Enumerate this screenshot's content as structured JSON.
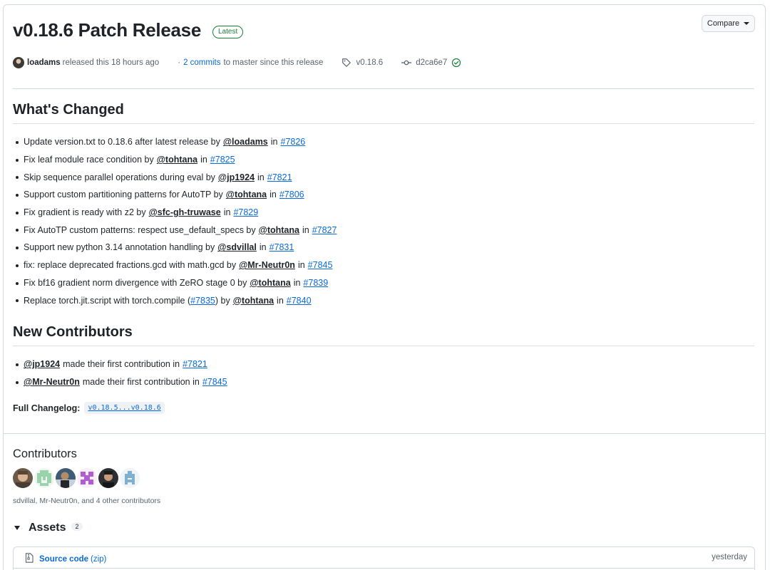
{
  "release": {
    "title": "v0.18.6 Patch Release",
    "badge": "Latest",
    "compare_label": "Compare",
    "author": "loadams",
    "released_text": "released this 18 hours ago",
    "commits_link": "2 commits",
    "commits_suffix": "to master since this release",
    "tag": "v0.18.6",
    "commit_sha": "d2ca6e7"
  },
  "whats_changed": {
    "heading": "What's Changed",
    "items": [
      {
        "text": "Update version.txt to 0.18.6 after latest release by",
        "user": "@loadams",
        "in": "in",
        "pr": "#7826"
      },
      {
        "text": "Fix leaf module race condition by",
        "user": "@tohtana",
        "in": "in",
        "pr": "#7825"
      },
      {
        "text": "Skip sequence parallel operations during eval by",
        "user": "@jp1924",
        "in": "in",
        "pr": "#7821"
      },
      {
        "text": "Support custom partitioning patterns for AutoTP by",
        "user": "@tohtana",
        "in": "in",
        "pr": "#7806"
      },
      {
        "text": "Fix gradient is ready with z2 by",
        "user": "@sfc-gh-truwase",
        "in": "in",
        "pr": "#7829"
      },
      {
        "text": "Fix AutoTP custom patterns: respect use_default_specs by",
        "user": "@tohtana",
        "in": "in",
        "pr": "#7827"
      },
      {
        "text": "Support new python 3.14 annotation handling by",
        "user": "@sdvillal",
        "in": "in",
        "pr": "#7831"
      },
      {
        "text": "fix: replace deprecated fractions.gcd with math.gcd by",
        "user": "@Mr-Neutr0n",
        "in": "in",
        "pr": "#7845"
      },
      {
        "text": "Fix bf16 gradient norm divergence with ZeRO stage 0 by",
        "user": "@tohtana",
        "in": "in",
        "pr": "#7839"
      }
    ],
    "last_item": {
      "prefix": "Replace torch.jit.script with torch.compile (",
      "inner_pr": "#7835",
      "mid": ") by",
      "user": "@tohtana",
      "in": "in",
      "pr": "#7840"
    }
  },
  "new_contributors": {
    "heading": "New Contributors",
    "items": [
      {
        "user": "@jp1924",
        "text": "made their first contribution in",
        "pr": "#7821"
      },
      {
        "user": "@Mr-Neutr0n",
        "text": "made their first contribution in",
        "pr": "#7845"
      }
    ]
  },
  "changelog": {
    "label": "Full Changelog",
    "colon": ":",
    "range": "v0.18.5...v0.18.6"
  },
  "contributors": {
    "heading": "Contributors",
    "summary": "sdvillal, Mr-Neutr0n, and 4 other contributors"
  },
  "assets": {
    "heading": "Assets",
    "count": "2",
    "items": [
      {
        "name": "Source code",
        "ext": "(zip)",
        "date": "yesterday"
      }
    ]
  },
  "colors": {
    "link": "#0969da",
    "success": "#1a7f37",
    "border": "#d1d9e0"
  }
}
